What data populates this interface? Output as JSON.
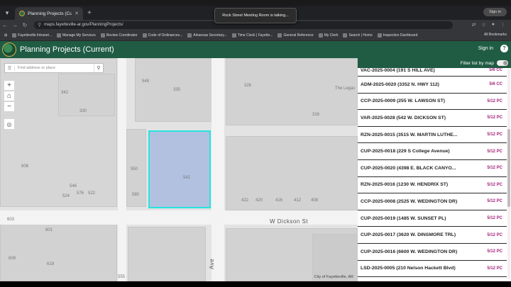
{
  "browser": {
    "tab": {
      "title": "Planning Projects (Current)"
    },
    "signin_pill": "Sign in",
    "address": "maps.fayetteville-ar.gov/PlanningProjects/",
    "bookmarks": [
      "Fayetteville Intranet...",
      "Manage My Services",
      "Review Coordinator",
      "Code of Ordinances...",
      "Arkansas Secretary...",
      "Time Clock | Fayette...",
      "General Reference",
      "My Clerk",
      "Search | Homo",
      "Inspection Dashboard"
    ],
    "all_bookmarks": "All Bookmarks"
  },
  "toast": {
    "text": "Rock Street Meeting Room is talking..."
  },
  "app": {
    "title": "Planning Projects (Current)",
    "signin": "Sign in",
    "help": "?"
  },
  "map": {
    "search_placeholder": "Find address or place",
    "zoom_in": "+",
    "zoom_out": "−",
    "home": "⌂",
    "locate": "◎",
    "street_label": "W Dickson St",
    "ave_label": "Ave",
    "attribution": "City of Fayetteville, AR",
    "poi_label": "The Legac",
    "numbers": [
      "548",
      "335",
      "326",
      "342",
      "330",
      "316",
      "608",
      "550",
      "542",
      "524",
      "576",
      "522",
      "546",
      "580",
      "422",
      "420",
      "416",
      "412",
      "408",
      "603",
      "601",
      "609",
      "555",
      "619"
    ]
  },
  "panel": {
    "filter_label": "Filter list by map",
    "projects": [
      {
        "name": "VAC-2025-0004 (191 S HILL AVE)",
        "date": "5/6 CC"
      },
      {
        "name": "ADM-2025-0020 (3352 N. HWY 112)",
        "date": "5/6 CC"
      },
      {
        "name": "CCP-2025-0009 (255 W. LAWSON ST)",
        "date": "5/12 PC"
      },
      {
        "name": "VAR-2025-0028 (542 W. DICKSON ST)",
        "date": "5/12 PC"
      },
      {
        "name": "RZN-2025-0015 (3515 W. MARTIN LUTHE...",
        "date": "5/12 PC"
      },
      {
        "name": "CUP-2025-0018 (229 S College Avenue)",
        "date": "5/12 PC"
      },
      {
        "name": "CUP-2025-0020 (4398 E. BLACK CANYO...",
        "date": "5/12 PC"
      },
      {
        "name": "RZN-2025-0016 (1230 W. HENDRIX ST)",
        "date": "5/12 PC"
      },
      {
        "name": "CCP-2025-0008 (2525 W. WEDINGTON DR)",
        "date": "5/12 PC"
      },
      {
        "name": "CUP-2025-0019 (1485 W. SUNSET PL)",
        "date": "5/12 PC"
      },
      {
        "name": "CUP-2025-0017 (3620 W. DINSMORE TRL)",
        "date": "5/12 PC"
      },
      {
        "name": "CUP-2025-0016 (6600 W. WEDINGTON DR)",
        "date": "5/12 PC"
      },
      {
        "name": "LSD-2025-0005 (210 Nelson Hackett Blvd)",
        "date": "5/12 PC"
      }
    ]
  }
}
